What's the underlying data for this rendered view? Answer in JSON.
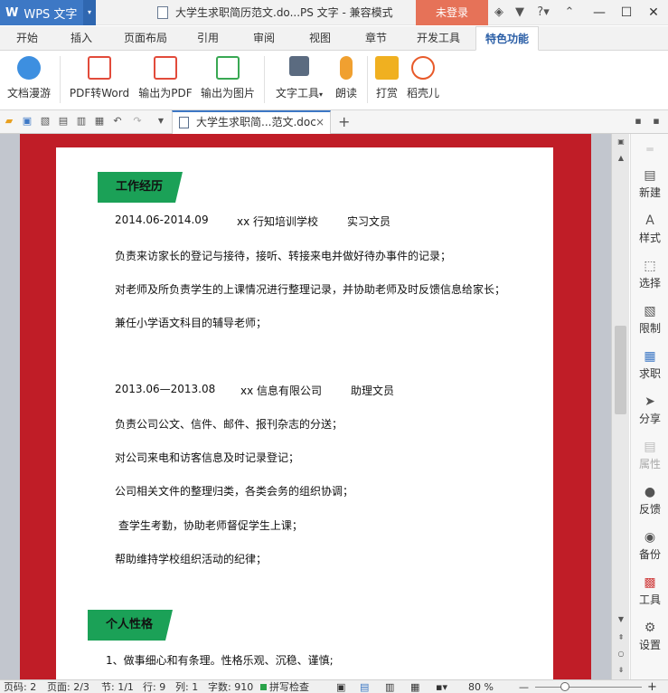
{
  "title_bar": {
    "app_logo": "W",
    "app_name": "WPS 文字",
    "dropdown": "▾",
    "doc_title": "大学生求职简历范文.do...PS 文字 - 兼容模式",
    "login_button": "未登录",
    "icons": [
      "skin-icon",
      "shirt-icon",
      "help-icon",
      "collapse-icon"
    ],
    "help_label": "?",
    "win_controls": [
      "minimize",
      "maximize",
      "close"
    ]
  },
  "menu_tabs": [
    "开始",
    "插入",
    "页面布局",
    "引用",
    "审阅",
    "视图",
    "章节",
    "开发工具",
    "特色功能"
  ],
  "active_tab": "特色功能",
  "ribbon": {
    "buttons": [
      {
        "label": "文档漫游",
        "icon": "cloud-icon",
        "color": "#3d8fe0"
      },
      {
        "label": "PDF转Word",
        "icon": "pdf-to-word-icon",
        "color": "#e24b3b"
      },
      {
        "label": "输出为PDF",
        "icon": "export-pdf-icon",
        "color": "#e24b3b"
      },
      {
        "label": "输出为图片",
        "icon": "export-image-icon",
        "color": "#39a853"
      },
      {
        "label": "文字工具",
        "icon": "text-tools-icon",
        "color": "#5b6b80"
      },
      {
        "label": "朗读",
        "icon": "microphone-icon",
        "color": "#f0a030"
      },
      {
        "label": "打赏",
        "icon": "reward-icon",
        "color": "#f0b020"
      },
      {
        "label": "稻壳儿",
        "icon": "docer-icon",
        "color": "#e85a2a"
      }
    ]
  },
  "doc_tab": {
    "name": "大学生求职简...范文.doc",
    "close": "×",
    "add": "+"
  },
  "document": {
    "section1_title": "工作经历",
    "job1": {
      "date": "2014.06-2014.09",
      "org": "xx 行知培训学校",
      "role": "实习文员"
    },
    "job1_duties": [
      "负责来访家长的登记与接待，接听、转接来电并做好待办事件的记录；",
      "对老师及所负责学生的上课情况进行整理记录，并协助老师及时反馈信息给家长；",
      "兼任小学语文科目的辅导老师；"
    ],
    "job2": {
      "date": "2013.06—2013.08",
      "org": "xx 信息有限公司",
      "role": "助理文员"
    },
    "job2_duties": [
      "负责公司公文、信件、邮件、报刊杂志的分送；",
      "对公司来电和访客信息及时记录登记；",
      "公司相关文件的整理归类，各类会务的组织协调；",
      " 查学生考勤，协助老师督促学生上课；",
      "帮助维持学校组织活动的纪律；"
    ],
    "section2_title": "个人性格",
    "personality_1": "1、做事细心和有条理。性格乐观、沉稳、谨慎;"
  },
  "right_panel": [
    {
      "label": "新建",
      "icon": "new-icon",
      "glyph": "▤"
    },
    {
      "label": "样式",
      "icon": "style-icon",
      "glyph": "A"
    },
    {
      "label": "选择",
      "icon": "select-icon",
      "glyph": "⬚"
    },
    {
      "label": "限制",
      "icon": "restrict-icon",
      "glyph": "▧"
    },
    {
      "label": "求职",
      "icon": "briefcase-icon",
      "glyph": "▦"
    },
    {
      "label": "分享",
      "icon": "share-icon",
      "glyph": "➤"
    },
    {
      "label": "属性",
      "icon": "properties-icon",
      "glyph": "▤"
    },
    {
      "label": "反馈",
      "icon": "feedback-icon",
      "glyph": "●"
    },
    {
      "label": "备份",
      "icon": "backup-icon",
      "glyph": "◉"
    },
    {
      "label": "工具",
      "icon": "toolbox-icon",
      "glyph": "▩"
    },
    {
      "label": "设置",
      "icon": "settings-icon",
      "glyph": "⚙"
    }
  ],
  "status_bar": {
    "page_num": "页码: 2",
    "pages": "页面: 2/3",
    "section": "节: 1/1",
    "row": "行: 9",
    "col": "列: 1",
    "words": "字数: 910",
    "spell": "拼写检查",
    "zoom": "80 %",
    "zoom_minus": "—",
    "zoom_plus": "+"
  }
}
